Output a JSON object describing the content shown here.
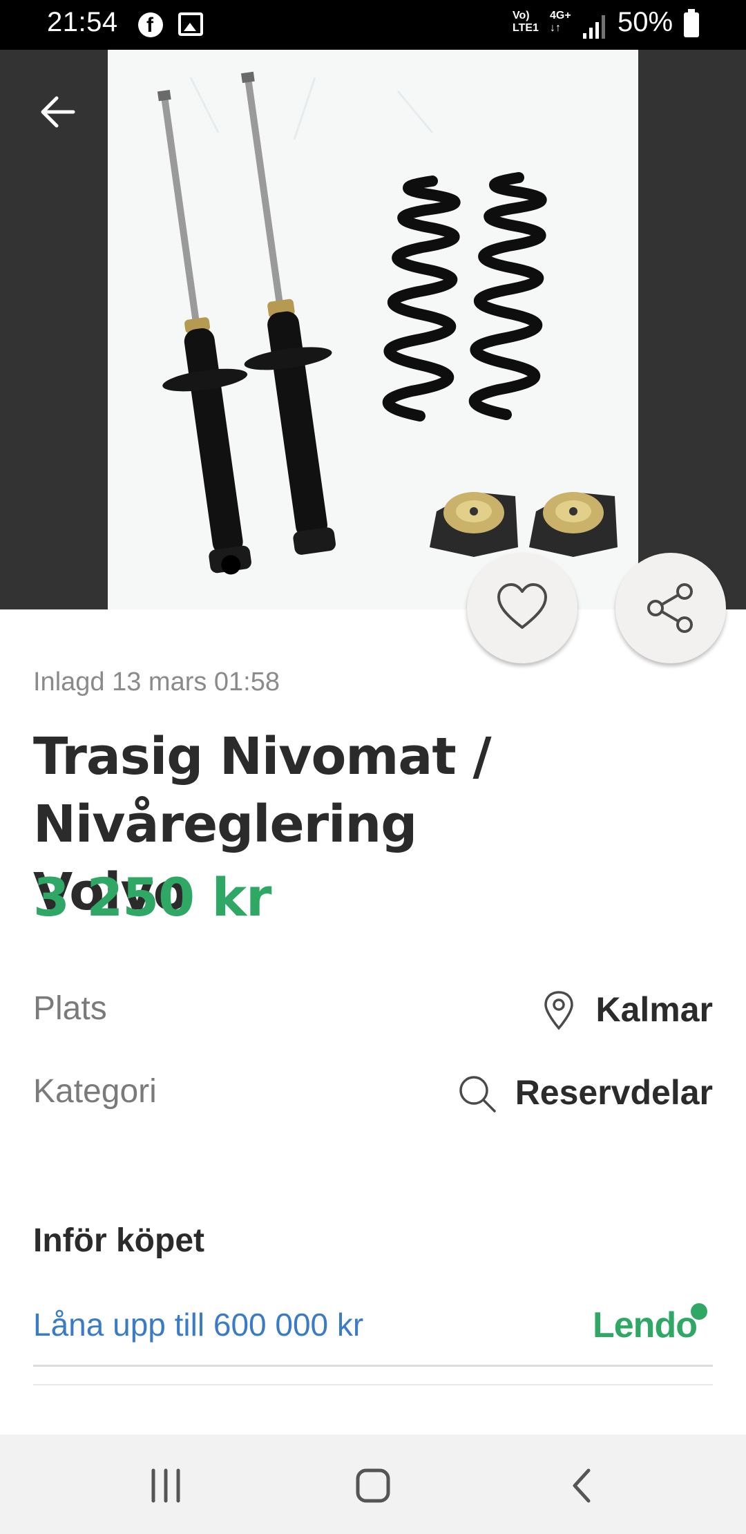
{
  "status_bar": {
    "time": "21:54",
    "network_top": "Vo)",
    "network_bottom": "LTE1",
    "net_type_top": "4G+",
    "net_type_bottom": "↓↑",
    "battery": "50%",
    "icons": [
      "facebook-icon",
      "gallery-icon",
      "signal-icon",
      "battery-icon"
    ]
  },
  "listing": {
    "posted": "Inlagd 13 mars 01:58",
    "title": "Trasig Nivomat / Nivåreglering Volvo",
    "price": "3 250 kr",
    "details": {
      "location_label": "Plats",
      "location_value": "Kalmar",
      "category_label": "Kategori",
      "category_value": "Reservdelar"
    }
  },
  "purchase": {
    "heading": "Inför köpet",
    "loan_link": "Låna upp till 600 000 kr",
    "partner": "Lendo"
  },
  "colors": {
    "price_green": "#2fa865",
    "link_blue": "#3a7bc8",
    "image_backdrop": "#333333"
  }
}
